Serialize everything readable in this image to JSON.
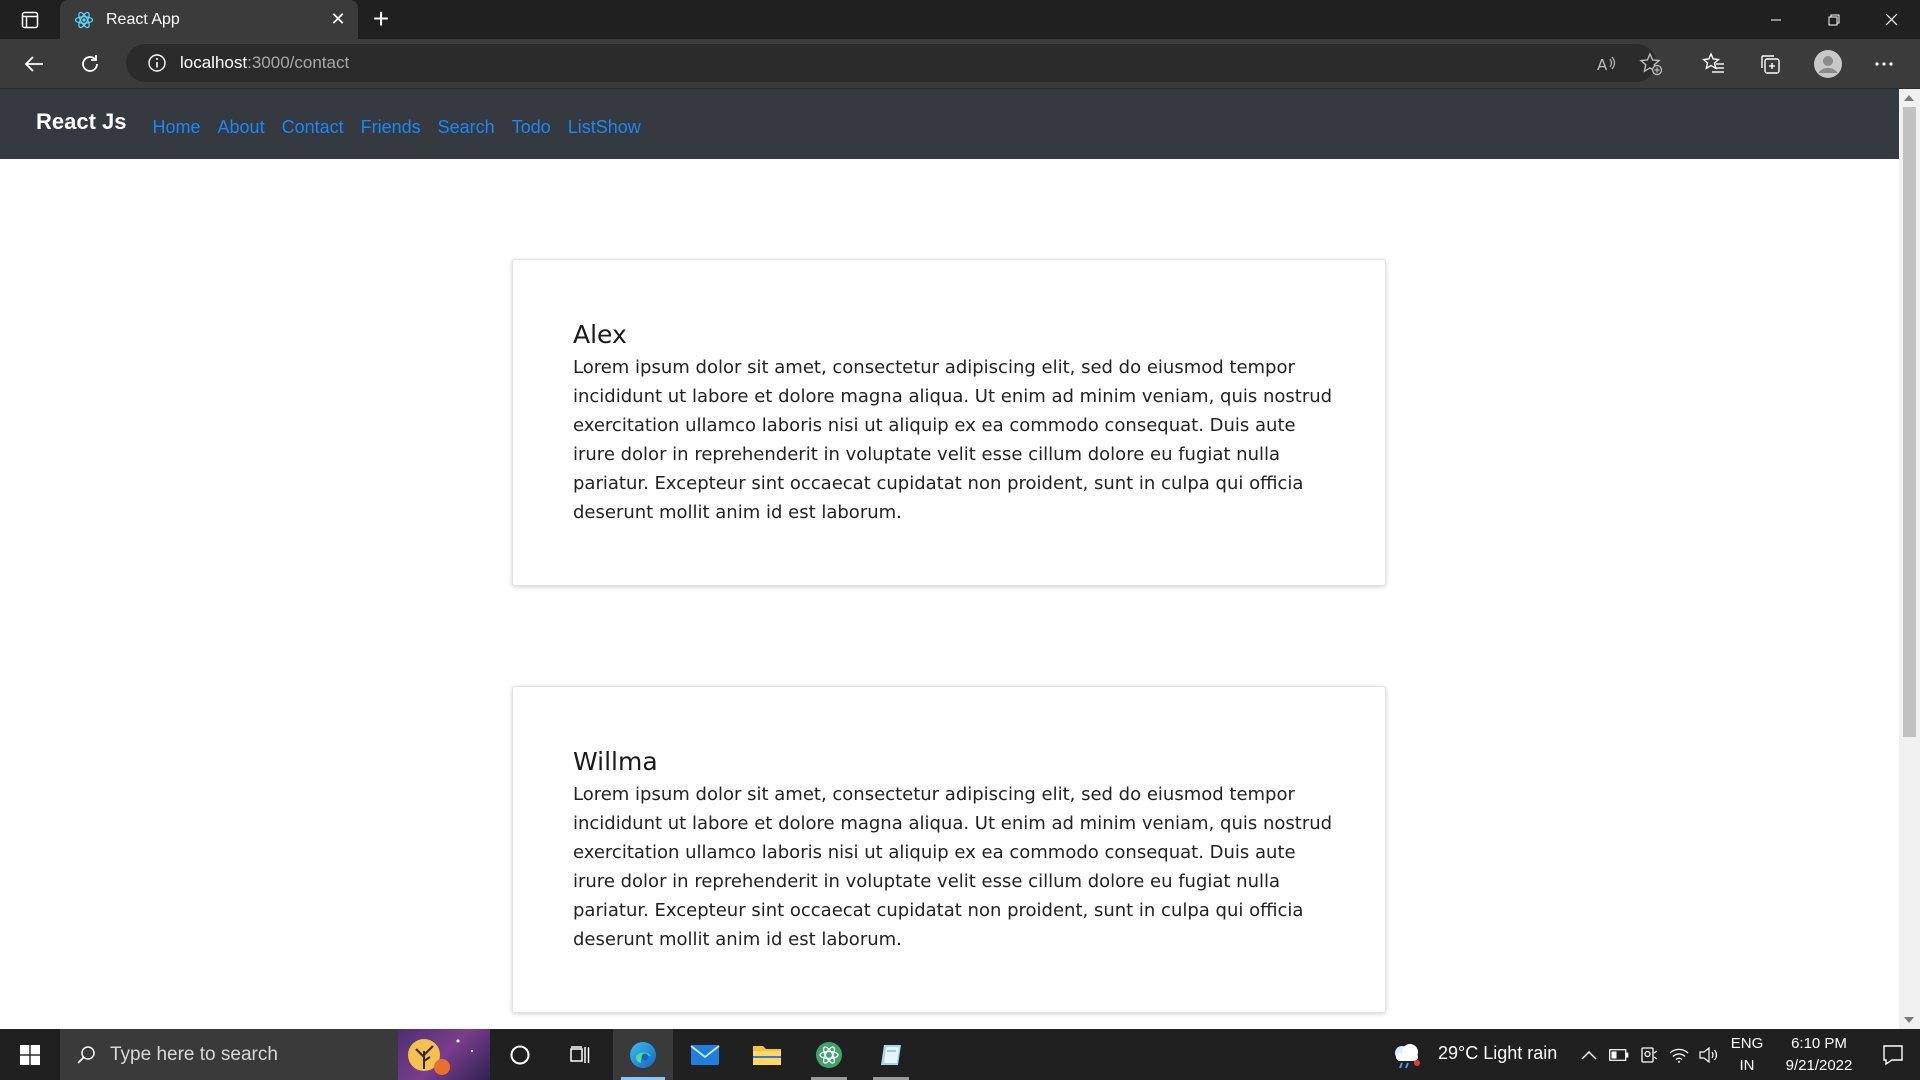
{
  "browser": {
    "tab_title": "React App",
    "url_host": "localhost",
    "url_path": ":3000/contact"
  },
  "navbar": {
    "brand": "React Js",
    "links": [
      "Home",
      "About",
      "Contact",
      "Friends",
      "Search",
      "Todo",
      "ListShow"
    ]
  },
  "cards": [
    {
      "name": "Alex",
      "text": "Lorem ipsum dolor sit amet, consectetur adipiscing elit, sed do eiusmod tempor incididunt ut labore et dolore magna aliqua. Ut enim ad minim veniam, quis nostrud exercitation ullamco laboris nisi ut aliquip ex ea commodo consequat. Duis aute irure dolor in reprehenderit in voluptate velit esse cillum dolore eu fugiat nulla pariatur. Excepteur sint occaecat cupidatat non proident, sunt in culpa qui officia deserunt mollit anim id est laborum."
    },
    {
      "name": "Willma",
      "text": "Lorem ipsum dolor sit amet, consectetur adipiscing elit, sed do eiusmod tempor incididunt ut labore et dolore magna aliqua. Ut enim ad minim veniam, quis nostrud exercitation ullamco laboris nisi ut aliquip ex ea commodo consequat. Duis aute irure dolor in reprehenderit in voluptate velit esse cillum dolore eu fugiat nulla pariatur. Excepteur sint occaecat cupidatat non proident, sunt in culpa qui officia deserunt mollit anim id est laborum."
    }
  ],
  "taskbar": {
    "search_placeholder": "Type here to search",
    "weather": "29°C  Light rain",
    "language_top": "ENG",
    "language_bottom": "IN",
    "time": "6:10 PM",
    "date": "9/21/2022"
  },
  "colors": {
    "navbar_bg": "#343a40",
    "nav_link": "#1d87f7",
    "browser_bg": "#202020"
  }
}
